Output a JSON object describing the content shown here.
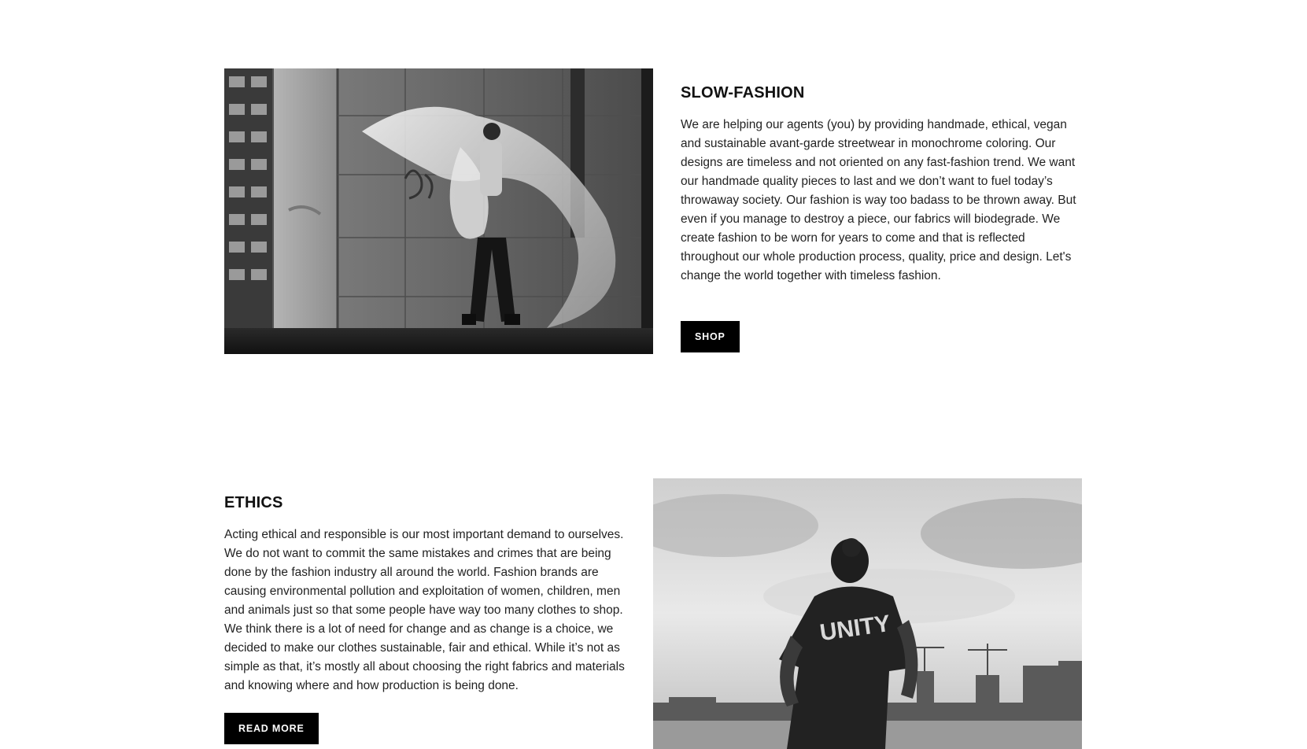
{
  "slow_fashion": {
    "heading": "SLOW-FASHION",
    "body": "We are helping our agents (you) by providing handmade, ethical, vegan and sustainable avant-garde streetwear in monochrome coloring. Our designs are timeless and not oriented on any fast-fashion trend. We want our handmade quality pieces to last and we don’t want to fuel today’s throwaway society. Our fashion is way too badass to be thrown away. But even if you manage to destroy a piece, our fabrics will biodegrade. We create fashion to be worn for years to come and that is reflected throughout our whole production process, quality, price and design. Let's change the world together with timeless fashion.",
    "button_label": "SHOP"
  },
  "ethics": {
    "heading": "ETHICS",
    "body": "Acting ethical and responsible is our most important demand to ourselves. We do not want to commit the same mistakes and crimes that are being done by the fashion industry all around the world. Fashion brands are causing environmental pollution and exploitation of women, children, men and animals just so that some people have way too many clothes to shop. We think there is a lot of need for change and as change is a choice, we decided to make our clothes sustainable, fair and ethical. While it’s not as simple as that, it’s mostly all about choosing the right fabrics and materials and knowing where and how production is being done.",
    "button_label": "READ MORE",
    "photo_shirt_text": "UNITY"
  }
}
